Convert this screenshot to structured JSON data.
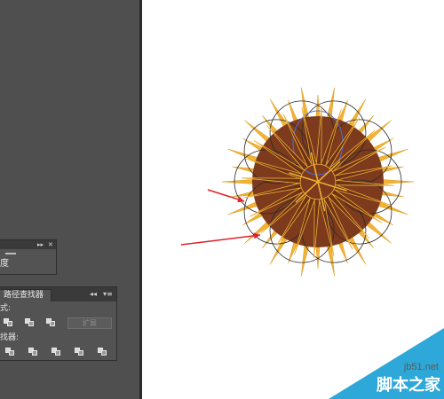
{
  "panel_small": {
    "controls": [
      "▸▸",
      "✕"
    ],
    "label": "度"
  },
  "pathfinder": {
    "tab_label": "路径查找器",
    "controls": [
      "◂◂",
      "▾≡"
    ],
    "row1_label": "式:",
    "row2_label": "找器:",
    "expand_label": "扩展",
    "shape_modes": [
      "unite-icon",
      "minus-front-icon",
      "intersect-icon",
      "exclude-icon"
    ],
    "pathfinders": [
      "divide-icon",
      "trim-icon",
      "merge-icon",
      "crop-icon",
      "outline-icon"
    ]
  },
  "canvas": {
    "artwork": "spiky-flower",
    "colors": {
      "spike_fill": "#f2b334",
      "inner_fill": "#7d3a1c",
      "outline": "#2a2a2a",
      "arrow": "#e0212a",
      "selection": "#4a6fe0"
    }
  },
  "watermark": {
    "site": "jb51.net",
    "name": "脚本之家",
    "color": "#2ea8d8"
  }
}
